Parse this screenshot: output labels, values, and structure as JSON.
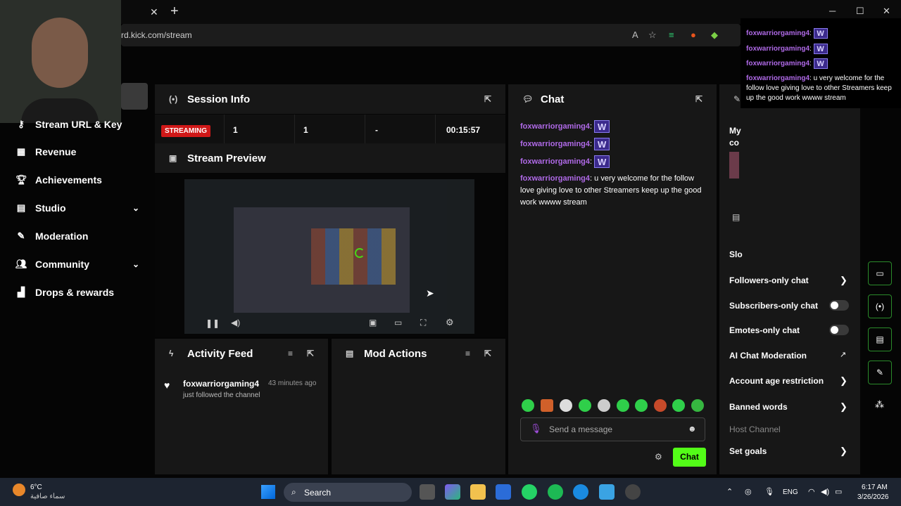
{
  "browser": {
    "url": "rd.kick.com/stream",
    "tab_close": "✕",
    "new_tab": "+",
    "win_min": "─",
    "win_max": "☐",
    "win_close": "✕"
  },
  "sidebar": {
    "items": [
      {
        "label": "Stream URL & Key",
        "icon": "key-icon"
      },
      {
        "label": "Revenue",
        "icon": "revenue-icon"
      },
      {
        "label": "Achievements",
        "icon": "trophy-icon"
      },
      {
        "label": "Studio",
        "icon": "studio-icon",
        "chevron": "⌄"
      },
      {
        "label": "Moderation",
        "icon": "wrench-icon"
      },
      {
        "label": "Community",
        "icon": "community-icon",
        "chevron": "⌄"
      },
      {
        "label": "Drops & rewards",
        "icon": "drops-icon"
      }
    ]
  },
  "session": {
    "title": "Session Info",
    "status": "STREAMING",
    "viewers": "1",
    "followers": "1",
    "category": "-",
    "duration": "00:15:57"
  },
  "preview": {
    "title": "Stream Preview"
  },
  "activity": {
    "title": "Activity Feed",
    "item_user": "foxwarriorgaming4",
    "item_time": "43 minutes ago",
    "item_text": "just followed the channel"
  },
  "mod_actions": {
    "title": "Mod Actions"
  },
  "chat": {
    "title": "Chat",
    "messages": [
      {
        "user": "foxwarriorgaming4",
        "text": ""
      },
      {
        "user": "foxwarriorgaming4",
        "text": ""
      },
      {
        "user": "foxwarriorgaming4",
        "text": ""
      },
      {
        "user": "foxwarriorgaming4",
        "text": "u very welcome for the follow love giving love to other Streamers keep up the good work wwww stream"
      }
    ],
    "emote_letter": "W",
    "placeholder": "Send a message",
    "send_label": "Chat"
  },
  "right_panel": {
    "partial_1": "My",
    "partial_2": "co",
    "partial_3": "Slo",
    "options": [
      {
        "label": "Followers-only chat",
        "control": "arrow"
      },
      {
        "label": "Subscribers-only chat",
        "control": "toggle"
      },
      {
        "label": "Emotes-only chat",
        "control": "toggle"
      },
      {
        "label": "AI Chat Moderation",
        "control": "external"
      },
      {
        "label": "Account age restriction",
        "control": "arrow"
      },
      {
        "label": "Banned words",
        "control": "arrow"
      },
      {
        "label": "Host Channel",
        "control": "none"
      },
      {
        "label": "Set goals",
        "control": "arrow"
      }
    ]
  },
  "overlay_chat": {
    "lines": [
      {
        "user": "foxwarriorgaming4",
        "text": ""
      },
      {
        "user": "foxwarriorgaming4",
        "text": ""
      },
      {
        "user": "foxwarriorgaming4",
        "text": ""
      },
      {
        "user": "foxwarriorgaming4",
        "text": "u very welcome for the follow love giving love to other Streamers keep up the good work wwww stream"
      }
    ]
  },
  "taskbar": {
    "weather_temp": "6°C",
    "weather_desc": "سماء صافية",
    "search_label": "Search",
    "lang": "ENG",
    "time": "6:17 AM",
    "date": "3/26/2026"
  },
  "colors": {
    "accent": "#53fc18",
    "username": "#b06ae8",
    "live": "#d01818"
  }
}
